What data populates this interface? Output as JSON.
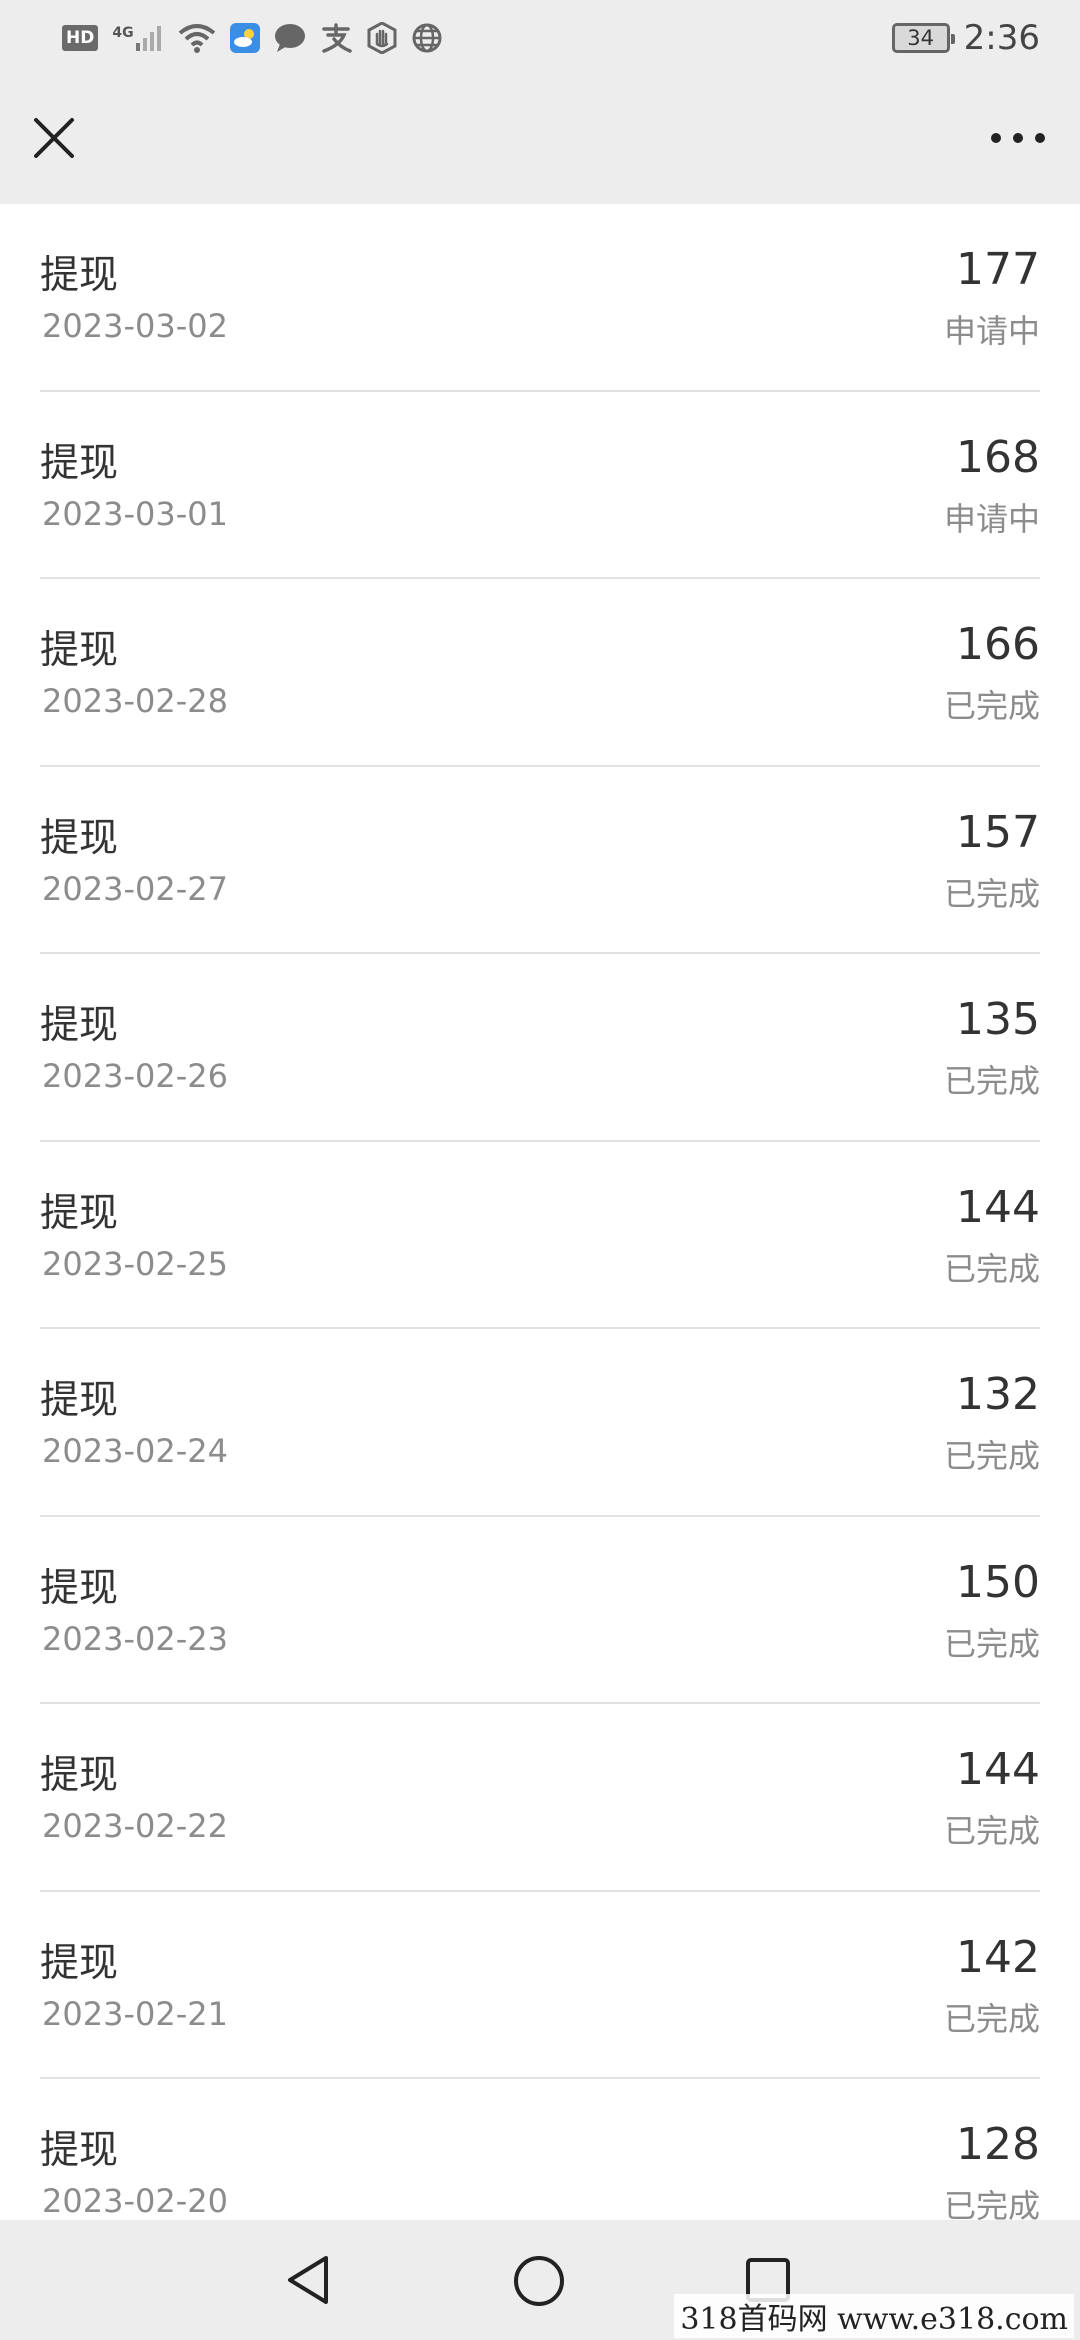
{
  "status_bar": {
    "network_badge": "HD",
    "network_type": "4G",
    "battery_level": "34",
    "time": "2:36",
    "icons": [
      "hd-icon",
      "cellular-signal-icon",
      "wifi-icon",
      "weather-app-icon",
      "chat-bubble-icon",
      "alipay-icon",
      "hand-icon",
      "globe-icon",
      "battery-icon"
    ]
  },
  "navbar": {
    "close_icon": "close-icon",
    "more_icon": "more-icon"
  },
  "records": [
    {
      "title": "提现",
      "date": "2023-03-02",
      "amount": "177",
      "status": "申请中"
    },
    {
      "title": "提现",
      "date": "2023-03-01",
      "amount": "168",
      "status": "申请中"
    },
    {
      "title": "提现",
      "date": "2023-02-28",
      "amount": "166",
      "status": "已完成"
    },
    {
      "title": "提现",
      "date": "2023-02-27",
      "amount": "157",
      "status": "已完成"
    },
    {
      "title": "提现",
      "date": "2023-02-26",
      "amount": "135",
      "status": "已完成"
    },
    {
      "title": "提现",
      "date": "2023-02-25",
      "amount": "144",
      "status": "已完成"
    },
    {
      "title": "提现",
      "date": "2023-02-24",
      "amount": "132",
      "status": "已完成"
    },
    {
      "title": "提现",
      "date": "2023-02-23",
      "amount": "150",
      "status": "已完成"
    },
    {
      "title": "提现",
      "date": "2023-02-22",
      "amount": "144",
      "status": "已完成"
    },
    {
      "title": "提现",
      "date": "2023-02-21",
      "amount": "142",
      "status": "已完成"
    },
    {
      "title": "提现",
      "date": "2023-02-20",
      "amount": "128",
      "status": "已完成"
    }
  ],
  "system_nav": {
    "icons": [
      "back-icon",
      "home-icon",
      "recents-icon"
    ]
  },
  "watermark": "318首码网 www.e318.com"
}
